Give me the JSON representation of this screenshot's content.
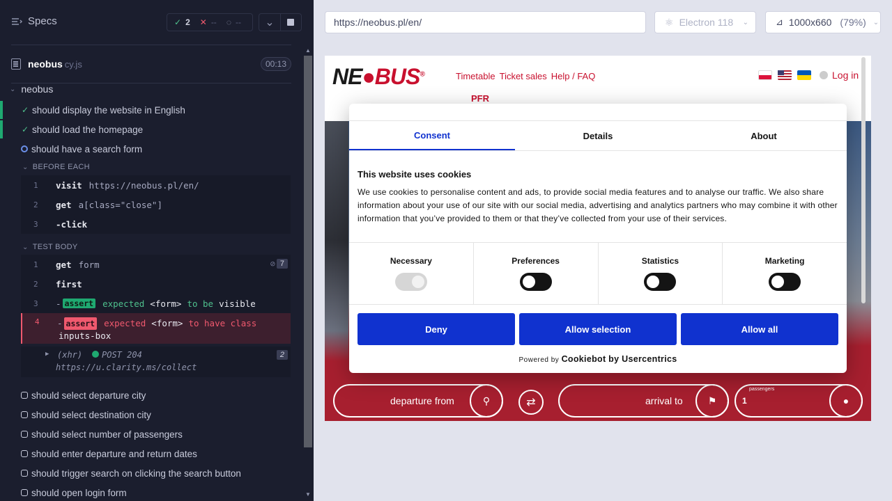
{
  "reporter": {
    "specs_label": "Specs",
    "stats": {
      "passed": "2",
      "failed": "--",
      "pending": "--"
    },
    "spec_file": {
      "name": "neobus",
      "ext": "cy.js",
      "duration": "00:13"
    },
    "suite_title": "neobus",
    "tests_top": [
      {
        "title": "should display the website in English",
        "state": "passed"
      },
      {
        "title": "should load the homepage",
        "state": "passed"
      },
      {
        "title": "should have a search form",
        "state": "running"
      }
    ],
    "before_each": {
      "label": "BEFORE EACH",
      "commands": [
        {
          "num": "1",
          "name": "visit",
          "arg": "https://neobus.pl/en/"
        },
        {
          "num": "2",
          "name": "get",
          "arg": "a[class=\"close\"]"
        },
        {
          "num": "3",
          "name": "-click",
          "arg": ""
        }
      ]
    },
    "test_body": {
      "label": "TEST BODY",
      "commands": [
        {
          "num": "1",
          "name": "get",
          "arg": "form",
          "count": "7"
        },
        {
          "num": "2",
          "name": "first",
          "arg": ""
        },
        {
          "num": "3",
          "badge": "assert",
          "t1": "expected",
          "code": "<form>",
          "t2": "to be",
          "t3": "visible"
        },
        {
          "num": "4",
          "badge": "assert",
          "t1": "expected",
          "code": "<form>",
          "t2": "to have class",
          "t3": "inputs-box"
        }
      ],
      "xhr": {
        "label": "(xhr)",
        "status": "POST 204",
        "url": "https://u.clarity.ms/collect",
        "count": "2"
      }
    },
    "tests_bottom": [
      "should select departure city",
      "should select destination city",
      "should select number of passengers",
      "should enter departure and return dates",
      "should trigger search on clicking the search button",
      "should open login form"
    ]
  },
  "runner": {
    "url": "https://neobus.pl/en/",
    "browser": "Electron 118",
    "viewport": "1000x660",
    "zoom": "(79%)"
  },
  "site": {
    "logo_ne": "NE",
    "logo_bus": "BUS",
    "logo_reg": "®",
    "nav": [
      "Timetable",
      "Ticket sales",
      "Help / FAQ"
    ],
    "login": "Log in",
    "pfr": "PFR",
    "departure": "departure from",
    "arrival": "arrival to",
    "passengers_label": "passengers",
    "passengers_value": "1"
  },
  "cookie": {
    "tabs": [
      "Consent",
      "Details",
      "About"
    ],
    "heading": "This website uses cookies",
    "body": "We use cookies to personalise content and ads, to provide social media features and to analyse our traffic. We also share information about your use of our site with our social media, advertising and analytics partners who may combine it with other information that you’ve provided to them or that they’ve collected from your use of their services.",
    "categories": [
      "Necessary",
      "Preferences",
      "Statistics",
      "Marketing"
    ],
    "buttons": {
      "deny": "Deny",
      "selection": "Allow selection",
      "all": "Allow all"
    },
    "powered_prefix": "Powered by",
    "powered_brand": "Cookiebot by Usercentrics"
  }
}
